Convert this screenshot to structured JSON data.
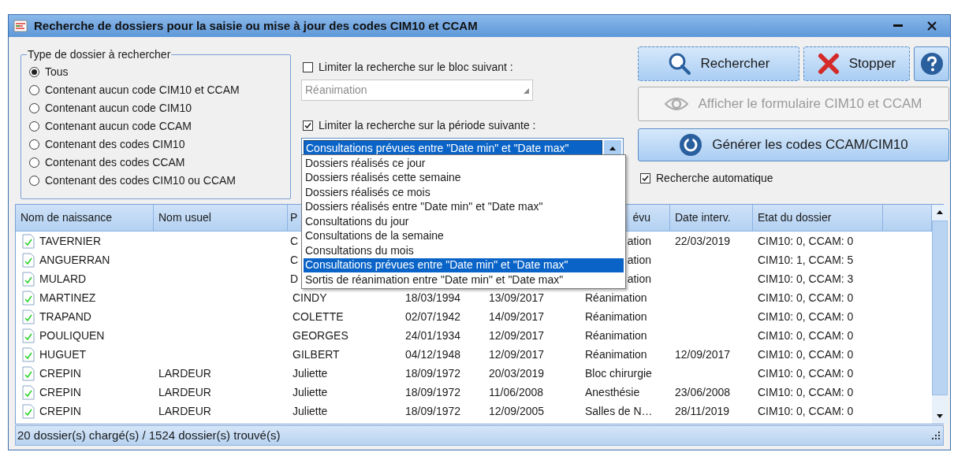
{
  "window": {
    "title": "Recherche de dossiers pour la saisie ou mise à jour des codes CIM10 et CCAM"
  },
  "type_group": {
    "legend": "Type de dossier à rechercher",
    "options": [
      {
        "label": "Tous",
        "selected": true
      },
      {
        "label": "Contenant aucun code CIM10 et CCAM",
        "selected": false
      },
      {
        "label": "Contenant aucun code CIM10",
        "selected": false
      },
      {
        "label": "Contenant aucun code CCAM",
        "selected": false
      },
      {
        "label": "Contenant des codes CIM10",
        "selected": false
      },
      {
        "label": "Contenant des codes CCAM",
        "selected": false
      },
      {
        "label": "Contenant des codes CIM10 ou CCAM",
        "selected": false
      }
    ]
  },
  "block_filter": {
    "label": "Limiter la recherche sur le bloc suivant :",
    "checked": false,
    "value": "Réanimation",
    "disabled": true
  },
  "period_filter": {
    "label": "Limiter la recherche sur la période suivante :",
    "checked": true,
    "value": "Consultations prévues entre \"Date min\" et \"Date max\"",
    "expanded": true,
    "options": [
      {
        "label": "Dossiers réalisés ce jour",
        "selected": false
      },
      {
        "label": "Dossiers réalisés cette semaine",
        "selected": false
      },
      {
        "label": "Dossiers réalisés ce mois",
        "selected": false
      },
      {
        "label": "Dossiers réalisés entre \"Date min\" et \"Date max\"",
        "selected": false
      },
      {
        "label": "Consultations du jour",
        "selected": false
      },
      {
        "label": "Consultations de la semaine",
        "selected": false
      },
      {
        "label": "Consultations du mois",
        "selected": false
      },
      {
        "label": "Consultations prévues entre \"Date min\" et \"Date max\"",
        "selected": true
      },
      {
        "label": "Sortis de réanimation entre \"Date min\" et \"Date max\"",
        "selected": false
      }
    ]
  },
  "top_buttons": [
    {
      "kind": "search",
      "label": "Rechercher",
      "disabled": false
    },
    {
      "kind": "stop",
      "label": "Stopper",
      "disabled": false
    },
    {
      "kind": "help",
      "disabled": false
    }
  ],
  "wide_buttons": [
    {
      "kind": "view",
      "label": "Afficher le formulaire CIM10 et CCAM",
      "disabled": true
    },
    {
      "kind": "generate",
      "label": "Générer les codes CCAM/CIM10",
      "disabled": false
    }
  ],
  "auto_search": {
    "label": "Recherche automatique",
    "checked": true
  },
  "table": {
    "columns": [
      {
        "label": "Nom de naissance"
      },
      {
        "label": "Nom usuel"
      },
      {
        "label": "P"
      },
      {},
      {},
      {
        "label": "évu"
      },
      {
        "label": "Date interv."
      },
      {
        "label": "Etat du dossier"
      },
      {}
    ],
    "rows": [
      [
        "TAVERNIER",
        null,
        "C",
        null,
        null,
        "ation",
        "22/03/2019",
        "CIM10: 0, CCAM: 0"
      ],
      [
        "ANGUERRAN",
        null,
        "C",
        null,
        null,
        "ation",
        null,
        "CIM10: 1, CCAM: 5"
      ],
      [
        "MULARD",
        null,
        "D",
        null,
        null,
        "ation",
        null,
        "CIM10: 0, CCAM: 3"
      ],
      [
        "MARTINEZ",
        null,
        "CINDY",
        "18/03/1994",
        "13/09/2017",
        "Réanimation",
        null,
        "CIM10: 0, CCAM: 0"
      ],
      [
        "TRAPAND",
        null,
        "COLETTE",
        "02/07/1942",
        "14/09/2017",
        "Réanimation",
        null,
        "CIM10: 0, CCAM: 0"
      ],
      [
        "POULIQUEN",
        null,
        "GEORGES",
        "24/01/1934",
        "12/09/2017",
        "Réanimation",
        null,
        "CIM10: 0, CCAM: 0"
      ],
      [
        "HUGUET",
        null,
        "GILBERT",
        "04/12/1948",
        "12/09/2017",
        "Réanimation",
        "12/09/2017",
        "CIM10: 0, CCAM: 0"
      ],
      [
        "CREPIN",
        "LARDEUR",
        "Juliette",
        "18/09/1972",
        "20/03/2019",
        "Bloc chirurgie",
        null,
        "CIM10: 0, CCAM: 0"
      ],
      [
        "CREPIN",
        "LARDEUR",
        "Juliette",
        "18/09/1972",
        "11/06/2008",
        "Anesthésie",
        "23/06/2008",
        "CIM10: 0, CCAM: 0"
      ],
      [
        "CREPIN",
        "LARDEUR",
        "Juliette",
        "18/09/1972",
        "12/09/2005",
        "Salles de N…",
        "28/11/2019",
        "CIM10: 0, CCAM: 0"
      ]
    ]
  },
  "status_bar": {
    "text": "20 dossier(s) chargé(s) / 1524 dossier(s) trouvé(s)"
  }
}
